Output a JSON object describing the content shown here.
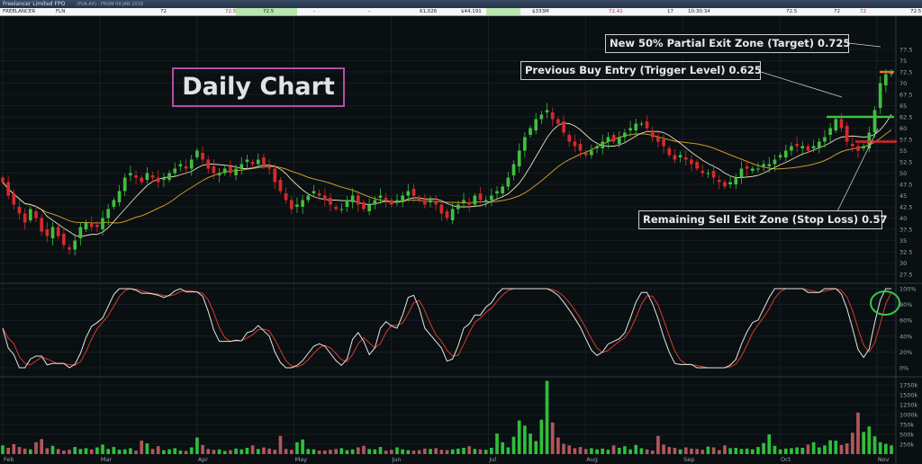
{
  "window": {
    "title": "Freelancer Limited FPO",
    "subtitle": "(FLN.AX) - FROM 09 JAN 2019"
  },
  "quote_bar": {
    "name": "FREELANCER",
    "code": "FLN",
    "cells": [
      "72",
      "72.5",
      "72.5",
      "-",
      "-",
      "61,026",
      "$44,191",
      "$333M",
      "72.41",
      "17",
      "10:30:34",
      "72.5",
      "72",
      "72",
      "72.5"
    ]
  },
  "annotations": {
    "big_label": "Daily Chart",
    "target": "New 50% Partial Exit Zone (Target) 0.725",
    "buy": "Previous Buy Entry (Trigger Level) 0.625",
    "stop": "Remaining Sell Exit Zone (Stop Loss) 0.57"
  },
  "colors": {
    "background": "#0a0f12",
    "grid": "#1e2a30",
    "up": "#3fbf3f",
    "down": "#d8292b",
    "ma_fast": "#e8dfb8",
    "ma_slow": "#c89a2a",
    "stoch_k": "#e6e6e6",
    "stoch_d": "#d83a2a",
    "target_line": "#e07a2a",
    "buy_line": "#3fbf3f",
    "stop_line": "#d8292b",
    "circle": "#35c84a",
    "vol_up": "#2fbf3a",
    "vol_down": "#b0575c"
  },
  "chart_data": [
    {
      "type": "candlestick",
      "name": "price",
      "x_months": [
        "Feb",
        "Mar",
        "Apr",
        "May",
        "Jun",
        "Jul",
        "Aug",
        "Sep",
        "Oct",
        "Nov"
      ],
      "y_ticks": [
        "77.5",
        "75",
        "72.5",
        "70",
        "67.5",
        "65",
        "62.5",
        "60",
        "57.5",
        "55",
        "52.5",
        "50",
        "47.5",
        "45",
        "42.5",
        "40",
        "37.5",
        "35",
        "32.5",
        "30",
        "27.5"
      ],
      "ylim": [
        26,
        78
      ],
      "close": [
        48,
        45,
        43,
        41,
        39,
        42,
        40,
        37,
        36,
        38,
        36,
        34,
        33,
        35,
        38,
        39,
        38,
        38,
        40,
        42,
        44,
        46,
        49,
        50,
        49,
        48,
        50,
        49,
        48,
        49,
        50,
        51,
        52,
        51,
        53,
        55,
        53,
        51,
        50,
        50,
        51,
        50,
        51,
        52,
        53,
        52,
        53,
        52,
        51,
        48,
        46,
        44,
        42,
        43,
        44,
        45,
        46,
        45,
        44,
        43,
        42,
        42,
        44,
        45,
        43,
        42,
        43,
        44,
        45,
        44,
        43,
        44,
        45,
        46,
        45,
        44,
        43,
        44,
        43,
        41,
        40,
        42,
        43,
        44,
        43,
        45,
        44,
        44,
        45,
        46,
        47,
        49,
        52,
        55,
        58,
        60,
        62,
        63,
        64,
        62,
        61,
        59,
        57,
        56,
        55,
        54,
        55,
        56,
        57,
        58,
        57,
        58,
        59,
        60,
        61,
        61,
        60,
        58,
        57,
        56,
        54,
        53,
        54,
        53,
        52,
        51,
        50,
        50,
        49,
        48,
        47,
        48,
        49,
        51,
        51,
        51,
        51,
        52,
        52,
        53,
        54,
        55,
        56,
        56,
        56,
        55,
        56,
        57,
        58,
        60,
        62,
        60,
        57,
        56,
        55,
        56,
        59,
        64,
        70,
        72,
        72.5
      ],
      "ma_fast_period": 8,
      "ma_slow_period": 20,
      "levels": {
        "target": 72.5,
        "buy": 62.5,
        "stop": 57
      }
    },
    {
      "type": "line",
      "name": "stochastic",
      "y_ticks": [
        "100%",
        "80%",
        "60%",
        "40%",
        "20%",
        "0%"
      ],
      "ylim": [
        0,
        100
      ]
    },
    {
      "type": "bar",
      "name": "volume",
      "y_ticks": [
        "1750k",
        "1500k",
        "1250k",
        "1000k",
        "750k",
        "500k",
        "250k"
      ],
      "ylim": [
        0,
        1900
      ],
      "values": [
        220,
        160,
        250,
        180,
        140,
        120,
        300,
        380,
        150,
        210,
        130,
        90,
        110,
        180,
        130,
        150,
        120,
        170,
        240,
        130,
        180,
        110,
        120,
        150,
        90,
        340,
        270,
        130,
        200,
        100,
        120,
        150,
        90,
        80,
        170,
        420,
        230,
        130,
        110,
        120,
        80,
        100,
        140,
        120,
        160,
        220,
        130,
        170,
        140,
        110,
        460,
        130,
        110,
        300,
        370,
        130,
        120,
        90,
        90,
        110,
        130,
        150,
        100,
        120,
        170,
        210,
        130,
        120,
        180,
        90,
        110,
        170,
        120,
        100,
        90,
        100,
        140,
        130,
        150,
        110,
        100,
        120,
        140,
        160,
        200,
        130,
        120,
        110,
        160,
        520,
        300,
        170,
        440,
        850,
        720,
        520,
        330,
        870,
        1850,
        800,
        420,
        260,
        220,
        150,
        180,
        130,
        150,
        120,
        140,
        110,
        220,
        160,
        200,
        120,
        230,
        150,
        120,
        90,
        460,
        240,
        180,
        160,
        120,
        170,
        140,
        130,
        110,
        190,
        170,
        100,
        220,
        150,
        160,
        130,
        140,
        120,
        180,
        280,
        500,
        210,
        120,
        140,
        150,
        170,
        160,
        240,
        300,
        170,
        220,
        350,
        340,
        230,
        270,
        540,
        1050,
        560,
        700,
        450,
        300,
        260,
        220
      ]
    }
  ]
}
